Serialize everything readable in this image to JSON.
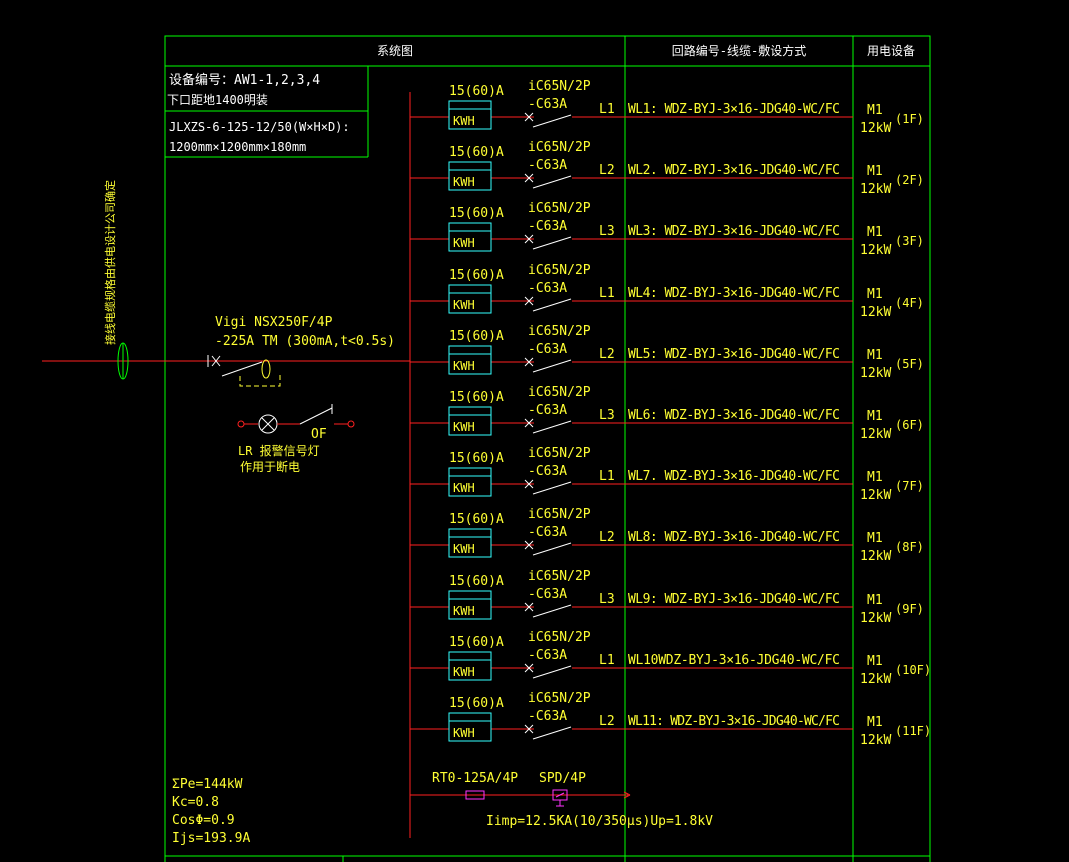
{
  "header": {
    "system_diagram": "系统图",
    "circuit_column": "回路编号-线缆-敷设方式",
    "load_column": "用电设备"
  },
  "device_info": {
    "line1": "设备编号：AW1-1,2,3,4",
    "line2": "下口距地1400明装",
    "line3": "JLXZS-6-125-12/50(W×H×D):",
    "line4": "1200mm×1200mm×180mm"
  },
  "incoming": {
    "vertical_note": "接线电缆规格由供电设计公司确定",
    "breaker_line1": "Vigi NSX250F/4P",
    "breaker_line2": "-225A TM (300mA,t<0.5s)",
    "of_label": "OF",
    "lamp_label1": "LR 报警信号灯",
    "lamp_label2": "作用于断电"
  },
  "circuits": [
    {
      "meter_rating": "15(60)A",
      "meter": "KWH",
      "breaker1": "iC65N/2P",
      "breaker2": "-C63A",
      "phase": "L1",
      "cable": "WL1: WDZ-BYJ-3×16-JDG40-WC/FC",
      "load_id": "M1",
      "load_kw": "12kW",
      "floor": "(1F)"
    },
    {
      "meter_rating": "15(60)A",
      "meter": "KWH",
      "breaker1": "iC65N/2P",
      "breaker2": "-C63A",
      "phase": "L2",
      "cable": "WL2. WDZ-BYJ-3×16-JDG40-WC/FC",
      "load_id": "M1",
      "load_kw": "12kW",
      "floor": "(2F)"
    },
    {
      "meter_rating": "15(60)A",
      "meter": "KWH",
      "breaker1": "iC65N/2P",
      "breaker2": "-C63A",
      "phase": "L3",
      "cable": "WL3: WDZ-BYJ-3×16-JDG40-WC/FC",
      "load_id": "M1",
      "load_kw": "12kW",
      "floor": "(3F)"
    },
    {
      "meter_rating": "15(60)A",
      "meter": "KWH",
      "breaker1": "iC65N/2P",
      "breaker2": "-C63A",
      "phase": "L1",
      "cable": "WL4: WDZ-BYJ-3×16-JDG40-WC/FC",
      "load_id": "M1",
      "load_kw": "12kW",
      "floor": "(4F)"
    },
    {
      "meter_rating": "15(60)A",
      "meter": "KWH",
      "breaker1": "iC65N/2P",
      "breaker2": "-C63A",
      "phase": "L2",
      "cable": "WL5: WDZ-BYJ-3×16-JDG40-WC/FC",
      "load_id": "M1",
      "load_kw": "12kW",
      "floor": "(5F)"
    },
    {
      "meter_rating": "15(60)A",
      "meter": "KWH",
      "breaker1": "iC65N/2P",
      "breaker2": "-C63A",
      "phase": "L3",
      "cable": "WL6: WDZ-BYJ-3×16-JDG40-WC/FC",
      "load_id": "M1",
      "load_kw": "12kW",
      "floor": "(6F)"
    },
    {
      "meter_rating": "15(60)A",
      "meter": "KWH",
      "breaker1": "iC65N/2P",
      "breaker2": "-C63A",
      "phase": "L1",
      "cable": "WL7. WDZ-BYJ-3×16-JDG40-WC/FC",
      "load_id": "M1",
      "load_kw": "12kW",
      "floor": "(7F)"
    },
    {
      "meter_rating": "15(60)A",
      "meter": "KWH",
      "breaker1": "iC65N/2P",
      "breaker2": "-C63A",
      "phase": "L2",
      "cable": "WL8: WDZ-BYJ-3×16-JDG40-WC/FC",
      "load_id": "M1",
      "load_kw": "12kW",
      "floor": "(8F)"
    },
    {
      "meter_rating": "15(60)A",
      "meter": "KWH",
      "breaker1": "iC65N/2P",
      "breaker2": "-C63A",
      "phase": "L3",
      "cable": "WL9: WDZ-BYJ-3×16-JDG40-WC/FC",
      "load_id": "M1",
      "load_kw": "12kW",
      "floor": "(9F)"
    },
    {
      "meter_rating": "15(60)A",
      "meter": "KWH",
      "breaker1": "iC65N/2P",
      "breaker2": "-C63A",
      "phase": "L1",
      "cable": "WL10WDZ-BYJ-3×16-JDG40-WC/FC",
      "load_id": "M1",
      "load_kw": "12kW",
      "floor": "(10F)"
    },
    {
      "meter_rating": "15(60)A",
      "meter": "KWH",
      "breaker1": "iC65N/2P",
      "breaker2": "-C63A",
      "phase": "L2",
      "cable": "WL11: WDZ-BYJ-3×16-JDG40-WC/FC",
      "load_id": "M1",
      "load_kw": "12kW",
      "floor": "(11F)"
    }
  ],
  "spd": {
    "fuse_label": "RT0-125A/4P",
    "spd_label": "SPD/4P",
    "spec": "Iimp=12.5KA(10/350μs)Up=1.8kV"
  },
  "summary": {
    "pe": "ΣPe=144kW",
    "kc": "Kc=0.8",
    "cos": "CosΦ=0.9",
    "ijs": "Ijs=193.9A"
  },
  "colors": {
    "frame": "#00ff00",
    "wire": "#ff2020",
    "text": "#ffff33",
    "meter": "#33ffff",
    "breaker": "#ffffff",
    "fuse": "#ff33ff"
  }
}
